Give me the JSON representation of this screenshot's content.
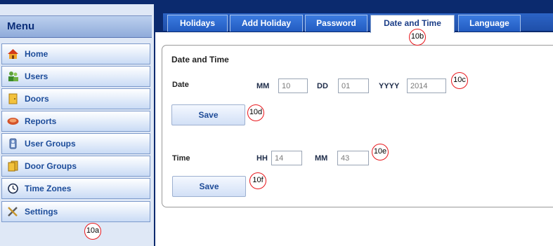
{
  "sidebar": {
    "title": "Menu",
    "items": [
      {
        "label": "Home",
        "icon": "home-icon"
      },
      {
        "label": "Users",
        "icon": "users-icon"
      },
      {
        "label": "Doors",
        "icon": "door-icon"
      },
      {
        "label": "Reports",
        "icon": "reports-icon"
      },
      {
        "label": "User Groups",
        "icon": "user-groups-icon"
      },
      {
        "label": "Door Groups",
        "icon": "door-groups-icon"
      },
      {
        "label": "Time Zones",
        "icon": "clock-icon"
      },
      {
        "label": "Settings",
        "icon": "tools-icon"
      }
    ]
  },
  "tabs": [
    {
      "label": "Holidays"
    },
    {
      "label": "Add Holiday"
    },
    {
      "label": "Password"
    },
    {
      "label": "Date and Time",
      "active": true
    },
    {
      "label": "Language"
    }
  ],
  "panel": {
    "title": "Date and Time",
    "date": {
      "label": "Date",
      "mm_label": "MM",
      "mm_value": "10",
      "dd_label": "DD",
      "dd_value": "01",
      "yyyy_label": "YYYY",
      "yyyy_value": "2014",
      "save_label": "Save"
    },
    "time": {
      "label": "Time",
      "hh_label": "HH",
      "hh_value": "14",
      "mm_label": "MM",
      "mm_value": "43",
      "save_label": "Save"
    }
  },
  "callouts": {
    "settings": "10a",
    "tab": "10b",
    "date_fields": "10c",
    "date_save": "10d",
    "time_fields": "10e",
    "time_save": "10f"
  },
  "colors": {
    "navy": "#0b2a6e",
    "tab_blue": "#2a66cf",
    "menu_text": "#1c4c9a",
    "callout_red": "#e8161b"
  }
}
